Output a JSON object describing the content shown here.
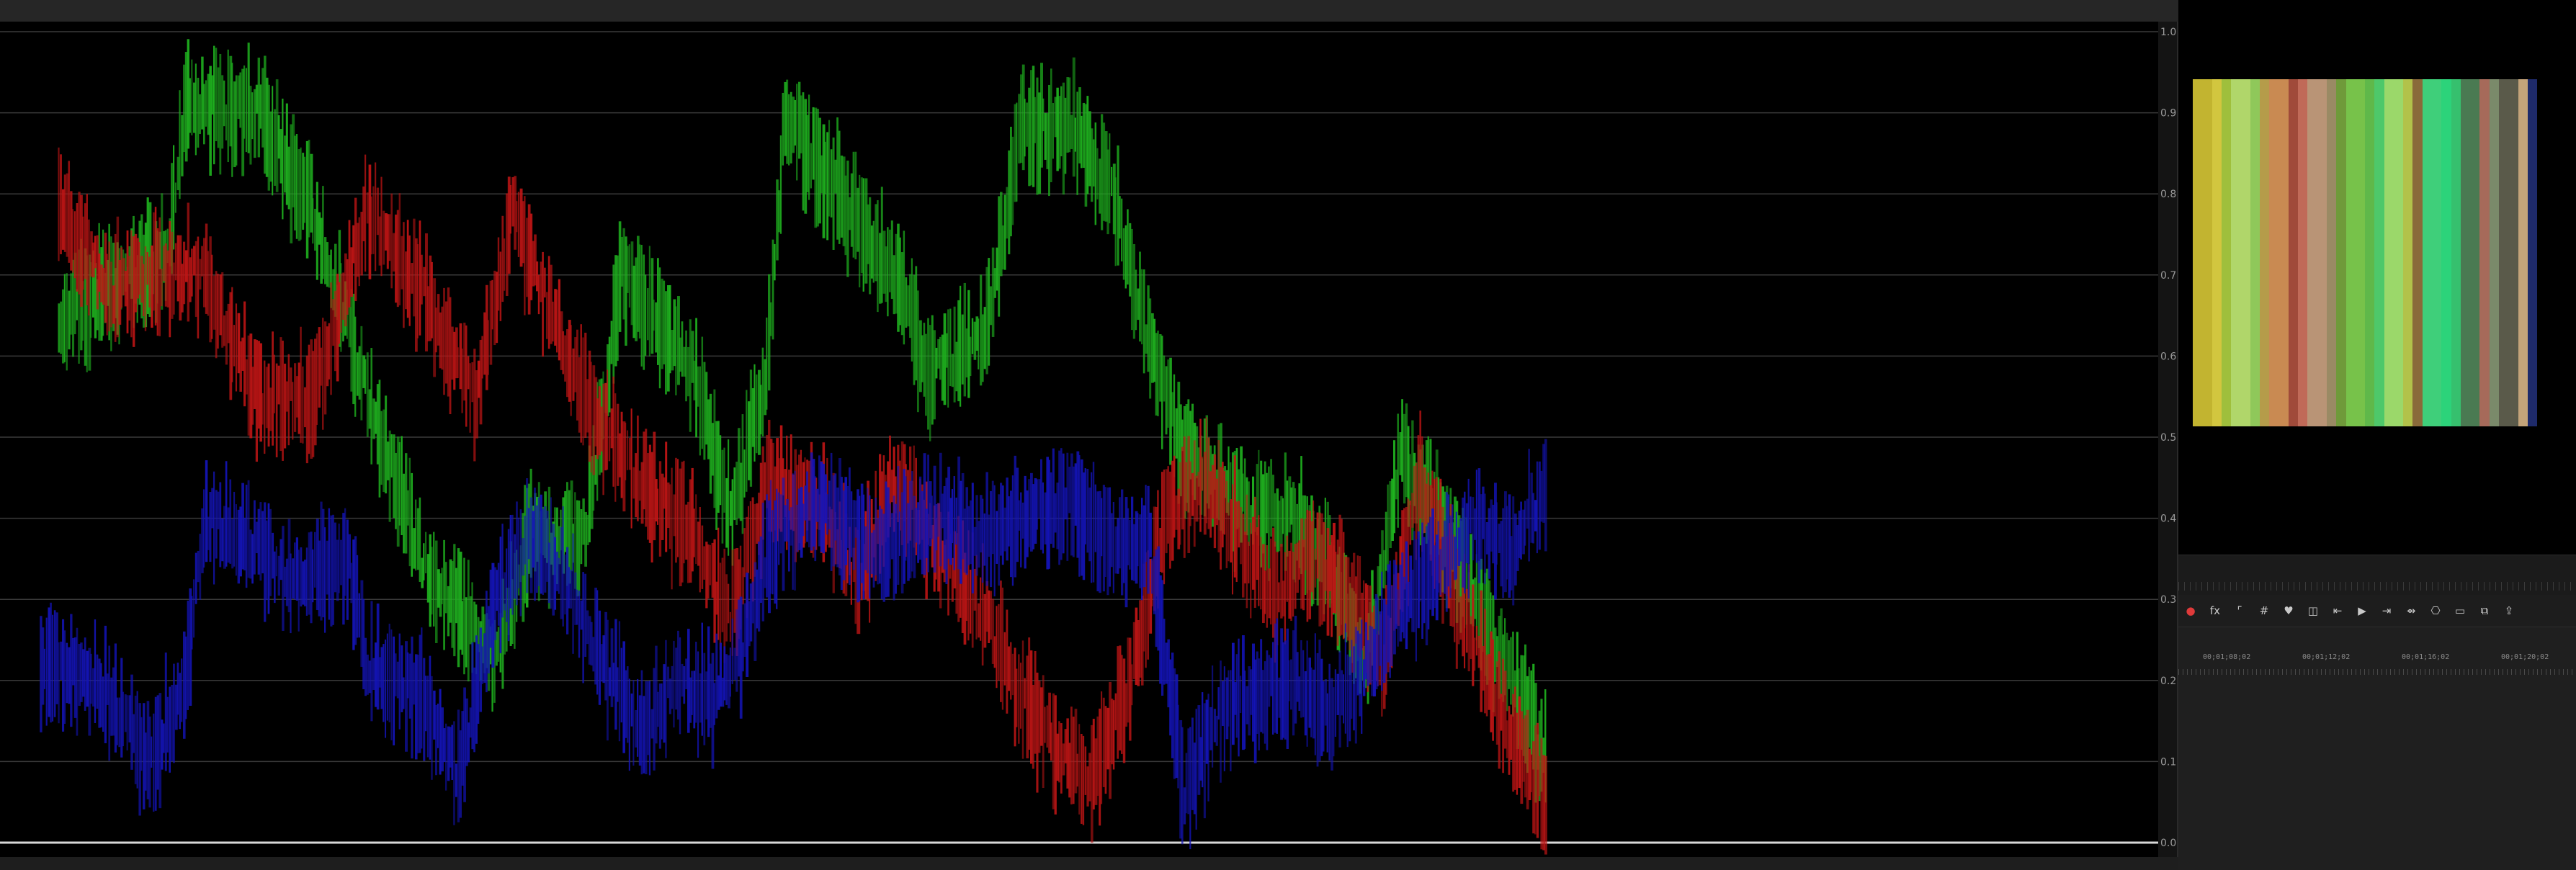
{
  "scope": {
    "axis_labels": [
      "1.0",
      "0.9",
      "0.8",
      "0.7",
      "0.6",
      "0.5",
      "0.4",
      "0.3",
      "0.2",
      "0.1",
      "0.0"
    ],
    "series": [
      {
        "color": "#1fb21f",
        "seed": 3,
        "segments": [
          [
            0.02,
            0.65
          ],
          [
            0.08,
            0.72
          ],
          [
            0.09,
            0.91
          ],
          [
            0.13,
            0.9
          ],
          [
            0.16,
            0.78
          ],
          [
            0.19,
            0.55
          ],
          [
            0.22,
            0.35
          ],
          [
            0.26,
            0.22
          ],
          [
            0.28,
            0.38
          ],
          [
            0.31,
            0.38
          ],
          [
            0.33,
            0.7
          ],
          [
            0.37,
            0.58
          ],
          [
            0.39,
            0.4
          ],
          [
            0.41,
            0.58
          ],
          [
            0.42,
            0.9
          ],
          [
            0.45,
            0.8
          ],
          [
            0.48,
            0.7
          ],
          [
            0.5,
            0.58
          ],
          [
            0.53,
            0.62
          ],
          [
            0.55,
            0.88
          ],
          [
            0.58,
            0.88
          ],
          [
            0.6,
            0.8
          ],
          [
            0.62,
            0.62
          ],
          [
            0.64,
            0.48
          ],
          [
            0.67,
            0.42
          ],
          [
            0.7,
            0.4
          ],
          [
            0.72,
            0.34
          ],
          [
            0.74,
            0.22
          ],
          [
            0.76,
            0.48
          ],
          [
            0.78,
            0.4
          ],
          [
            0.8,
            0.3
          ],
          [
            0.82,
            0.2
          ],
          [
            0.84,
            0.1
          ]
        ]
      },
      {
        "color": "#c01515",
        "seed": 11,
        "segments": [
          [
            0.02,
            0.78
          ],
          [
            0.05,
            0.68
          ],
          [
            0.07,
            0.7
          ],
          [
            0.1,
            0.7
          ],
          [
            0.13,
            0.55
          ],
          [
            0.16,
            0.55
          ],
          [
            0.19,
            0.78
          ],
          [
            0.22,
            0.68
          ],
          [
            0.25,
            0.55
          ],
          [
            0.27,
            0.78
          ],
          [
            0.29,
            0.66
          ],
          [
            0.31,
            0.55
          ],
          [
            0.33,
            0.48
          ],
          [
            0.35,
            0.42
          ],
          [
            0.37,
            0.38
          ],
          [
            0.39,
            0.28
          ],
          [
            0.41,
            0.44
          ],
          [
            0.44,
            0.42
          ],
          [
            0.46,
            0.32
          ],
          [
            0.48,
            0.45
          ],
          [
            0.5,
            0.38
          ],
          [
            0.53,
            0.28
          ],
          [
            0.55,
            0.18
          ],
          [
            0.57,
            0.12
          ],
          [
            0.59,
            0.08
          ],
          [
            0.61,
            0.2
          ],
          [
            0.63,
            0.4
          ],
          [
            0.65,
            0.45
          ],
          [
            0.67,
            0.38
          ],
          [
            0.69,
            0.3
          ],
          [
            0.71,
            0.36
          ],
          [
            0.73,
            0.3
          ],
          [
            0.75,
            0.22
          ],
          [
            0.77,
            0.45
          ],
          [
            0.79,
            0.3
          ],
          [
            0.81,
            0.18
          ],
          [
            0.83,
            0.08
          ],
          [
            0.84,
            0.06
          ]
        ]
      },
      {
        "color": "#1414b8",
        "seed": 23,
        "segments": [
          [
            0.01,
            0.22
          ],
          [
            0.04,
            0.2
          ],
          [
            0.07,
            0.1
          ],
          [
            0.09,
            0.2
          ],
          [
            0.1,
            0.4
          ],
          [
            0.12,
            0.38
          ],
          [
            0.15,
            0.32
          ],
          [
            0.18,
            0.35
          ],
          [
            0.19,
            0.22
          ],
          [
            0.22,
            0.18
          ],
          [
            0.24,
            0.08
          ],
          [
            0.26,
            0.3
          ],
          [
            0.28,
            0.38
          ],
          [
            0.3,
            0.32
          ],
          [
            0.32,
            0.22
          ],
          [
            0.34,
            0.14
          ],
          [
            0.36,
            0.2
          ],
          [
            0.38,
            0.18
          ],
          [
            0.4,
            0.26
          ],
          [
            0.41,
            0.36
          ],
          [
            0.44,
            0.42
          ],
          [
            0.47,
            0.36
          ],
          [
            0.5,
            0.4
          ],
          [
            0.53,
            0.38
          ],
          [
            0.55,
            0.4
          ],
          [
            0.58,
            0.42
          ],
          [
            0.6,
            0.36
          ],
          [
            0.62,
            0.38
          ],
          [
            0.64,
            0.06
          ],
          [
            0.66,
            0.16
          ],
          [
            0.68,
            0.18
          ],
          [
            0.7,
            0.2
          ],
          [
            0.72,
            0.16
          ],
          [
            0.74,
            0.22
          ],
          [
            0.76,
            0.3
          ],
          [
            0.78,
            0.34
          ],
          [
            0.8,
            0.4
          ],
          [
            0.82,
            0.36
          ],
          [
            0.84,
            0.44
          ]
        ]
      }
    ]
  },
  "swatch": {
    "stripes": [
      "#c2b430",
      "#d2c63f",
      "#9fbf3c",
      "#b0d66a",
      "#8fc85a",
      "#b59c4a",
      "#c98a52",
      "#a04a3a",
      "#c06a58",
      "#b99476",
      "#9a8a64",
      "#6f9a3a",
      "#77c24a",
      "#5fb84a",
      "#4ec86a",
      "#9bd86a",
      "#b2c24a",
      "#8a6a3a",
      "#3fcf7a",
      "#2cd37a",
      "#36c06e",
      "#4a7a52",
      "#a66a5a",
      "#7a8a6a",
      "#5a5a4a",
      "#c4a47a",
      "#1e2a6a"
    ]
  },
  "toolbar": {
    "tools": [
      {
        "name": "effect-record-icon",
        "glyph": "●",
        "color": "#e03a3a"
      },
      {
        "name": "fx-icon",
        "glyph": "fx"
      },
      {
        "name": "crop-corner-icon",
        "glyph": "⌜"
      },
      {
        "name": "grid-icon",
        "glyph": "#"
      },
      {
        "name": "marker-icon",
        "glyph": "♥"
      },
      {
        "name": "transform-icon",
        "glyph": "◫"
      },
      {
        "name": "go-to-in-point-icon",
        "glyph": "⇤"
      },
      {
        "name": "play-icon",
        "glyph": "▶"
      },
      {
        "name": "go-to-out-point-icon",
        "glyph": "⇥"
      },
      {
        "name": "step-forward-icon",
        "glyph": "⇴"
      },
      {
        "name": "camera-icon",
        "glyph": "⎔"
      },
      {
        "name": "safe-margins-icon",
        "glyph": "▭"
      },
      {
        "name": "multi-camera-icon",
        "glyph": "⧉"
      },
      {
        "name": "export-icon",
        "glyph": "⇪"
      }
    ]
  },
  "timeline": {
    "timecodes": [
      "00;01;08;02",
      "00;01;12;02",
      "00;01;16;02",
      "00;01;20;02"
    ]
  }
}
